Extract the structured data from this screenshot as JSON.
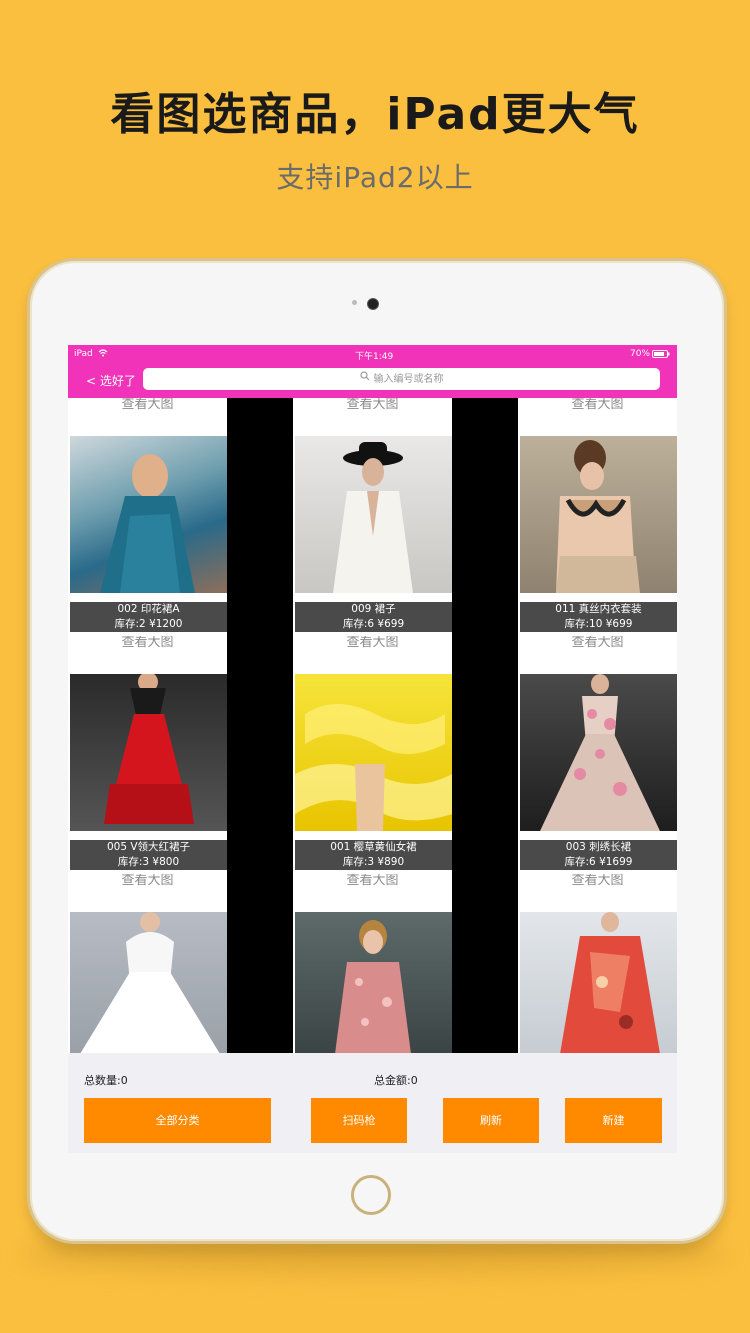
{
  "promo": {
    "headline": "看图选商品，iPad更大气",
    "subline": "支持iPad2以上"
  },
  "status_bar": {
    "device": "iPad",
    "time": "下午1:49",
    "battery": "70%"
  },
  "nav": {
    "back_label": "< 选好了",
    "search_placeholder": "输入编号或名称"
  },
  "products": [
    {
      "view_label": "查看大图",
      "title": "002 印花裙A",
      "stock_price": "库存:2  ¥1200"
    },
    {
      "view_label": "查看大图",
      "title": "009 裙子",
      "stock_price": "库存:6  ¥699"
    },
    {
      "view_label": "查看大图",
      "title": "011 真丝内衣套装",
      "stock_price": "库存:10  ¥699"
    },
    {
      "view_label": "查看大图",
      "title": "005 V领大红裙子",
      "stock_price": "库存:3  ¥800"
    },
    {
      "view_label": "查看大图",
      "title": "001 樱草黄仙女裙",
      "stock_price": "库存:3  ¥890"
    },
    {
      "view_label": "查看大图",
      "title": "003 刺绣长裙",
      "stock_price": "库存:6  ¥1699"
    },
    {
      "view_label": "查看大图",
      "title": "",
      "stock_price": ""
    },
    {
      "view_label": "查看大图",
      "title": "",
      "stock_price": ""
    },
    {
      "view_label": "查看大图",
      "title": "",
      "stock_price": ""
    }
  ],
  "summary": {
    "total_qty": "总数量:0",
    "total_amount": "总金额:0"
  },
  "buttons": {
    "all_categories": "全部分类",
    "scanner": "扫码枪",
    "refresh": "刷新",
    "new": "新建"
  },
  "colors": {
    "background": "#FBBF3F",
    "nav_pink": "#F033B8",
    "button_orange": "#FF8A00"
  }
}
